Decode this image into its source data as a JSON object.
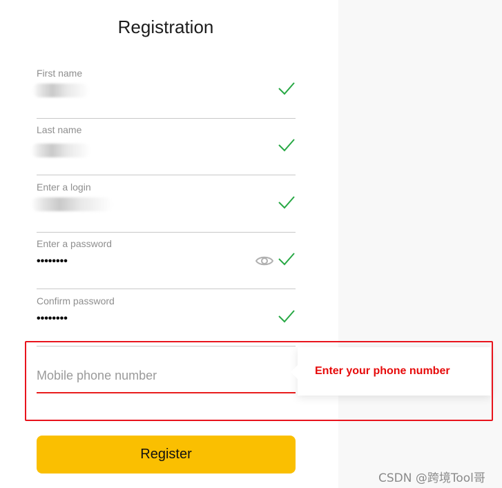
{
  "title": "Registration",
  "fields": {
    "first_name": {
      "label": "First name"
    },
    "last_name": {
      "label": "Last name"
    },
    "login": {
      "label": "Enter a login"
    },
    "password": {
      "label": "Enter a password",
      "value": "••••••••"
    },
    "confirm": {
      "label": "Confirm password",
      "value": "••••••••"
    }
  },
  "phone": {
    "placeholder": "Mobile phone number"
  },
  "tooltip": {
    "message": "Enter your phone number"
  },
  "register_label": "Register",
  "watermark": "CSDN @跨境Tool哥",
  "colors": {
    "accent_yellow": "#fabf01",
    "error_red": "#e8131c",
    "valid_green": "#27a844"
  },
  "icons": [
    "check-icon",
    "eye-icon"
  ]
}
